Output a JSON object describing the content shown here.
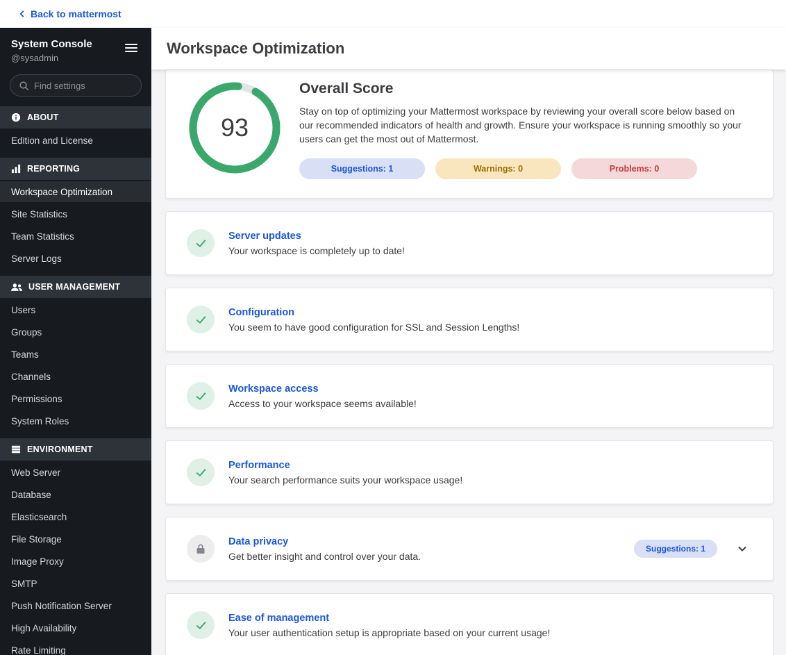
{
  "top_bar": {
    "back_link": "Back to mattermost"
  },
  "sidebar": {
    "title": "System Console",
    "subtitle": "@sysadmin",
    "search_placeholder": "Find settings",
    "sections": [
      {
        "label": "ABOUT",
        "icon": "info-icon",
        "items": [
          {
            "label": "Edition and License"
          }
        ]
      },
      {
        "label": "REPORTING",
        "icon": "bar-chart-icon",
        "items": [
          {
            "label": "Workspace Optimization",
            "active": true
          },
          {
            "label": "Site Statistics"
          },
          {
            "label": "Team Statistics"
          },
          {
            "label": "Server Logs"
          }
        ]
      },
      {
        "label": "USER MANAGEMENT",
        "icon": "users-icon",
        "items": [
          {
            "label": "Users"
          },
          {
            "label": "Groups"
          },
          {
            "label": "Teams"
          },
          {
            "label": "Channels"
          },
          {
            "label": "Permissions"
          },
          {
            "label": "System Roles"
          }
        ]
      },
      {
        "label": "ENVIRONMENT",
        "icon": "server-icon",
        "items": [
          {
            "label": "Web Server"
          },
          {
            "label": "Database"
          },
          {
            "label": "Elasticsearch"
          },
          {
            "label": "File Storage"
          },
          {
            "label": "Image Proxy"
          },
          {
            "label": "SMTP"
          },
          {
            "label": "Push Notification Server"
          },
          {
            "label": "High Availability"
          },
          {
            "label": "Rate Limiting"
          }
        ]
      }
    ]
  },
  "header": {
    "title": "Workspace Optimization"
  },
  "overview": {
    "score": "93",
    "title": "Overall Score",
    "description": "Stay on top of optimizing your Mattermost workspace by reviewing your overall score below based on our recommended indicators of health and growth. Ensure your workspace is running smoothly so your users can get the most out of Mattermost.",
    "badges": [
      {
        "label": "Suggestions: 1",
        "type": "info"
      },
      {
        "label": "Warnings: 0",
        "type": "warning"
      },
      {
        "label": "Problems: 0",
        "type": "error"
      }
    ]
  },
  "cards": [
    {
      "title": "Server updates",
      "icon": "check",
      "description": "Your workspace is completely up to date!"
    },
    {
      "title": "Configuration",
      "icon": "check",
      "description": "You seem to have good configuration for SSL and Session Lengths!"
    },
    {
      "title": "Workspace access",
      "icon": "check",
      "description": "Access to your workspace seems available!"
    },
    {
      "title": "Performance",
      "icon": "check",
      "description": "Your search performance suits your workspace usage!"
    },
    {
      "title": "Data privacy",
      "icon": "lock",
      "description": "Get better insight and control over your data.",
      "badge": "Suggestions: 1",
      "expandable": true
    },
    {
      "title": "Ease of management",
      "icon": "check",
      "description": "Your user authentication setup is appropriate based on your current usage!"
    }
  ],
  "colors": {
    "accent_blue": "#1c58d9",
    "success_green": "#3aa76d",
    "warning_amber": "#9d6f00",
    "danger_red": "#c43c3e",
    "sidebar_bg": "#171b1f"
  }
}
